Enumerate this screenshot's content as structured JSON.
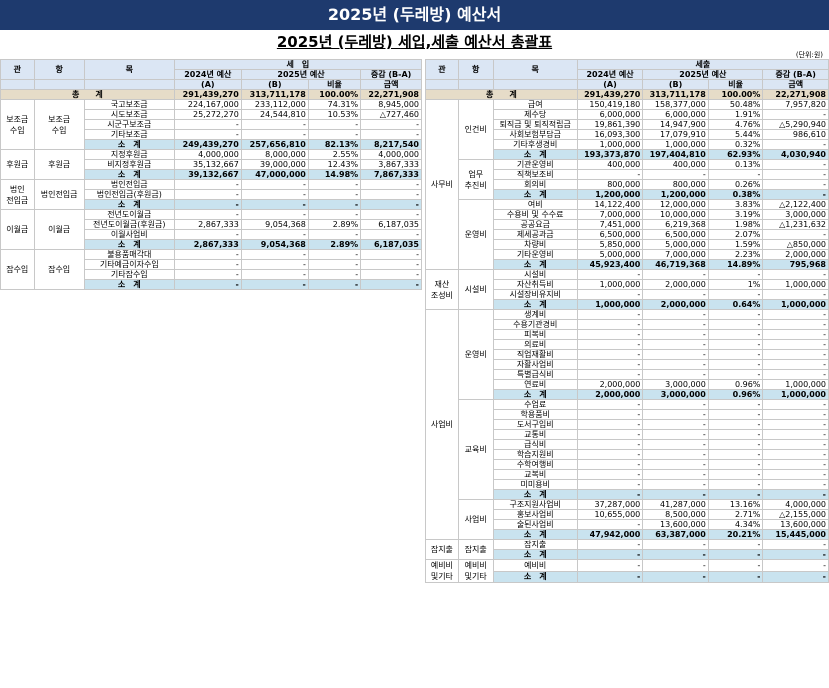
{
  "title": "2025년 (두레방) 예산서",
  "subtitle": "2025년 (두레방) 세입,세출 예산서 총괄표",
  "unit": "(단위:원)",
  "income": {
    "section": "세　입",
    "h": {
      "gwan": "관",
      "hang": "항",
      "mok": "목",
      "y2024": "2024년 예산",
      "y2025": "2025년 예산",
      "ratio": "비율",
      "diff": "증감 (B-A)",
      "a": "(A)",
      "b": "(B)",
      "amount": "금액"
    },
    "total": {
      "label": "총　　계",
      "a": "291,439,270",
      "b": "313,711,178",
      "r": "100.00%",
      "d": "22,271,908"
    },
    "groups": [
      {
        "gwan": "보조금\n수입",
        "hang": "보조금\n수입",
        "rows": [
          {
            "mok": "국고보조금",
            "a": "224,167,000",
            "b": "233,112,000",
            "r": "74.31%",
            "d": "8,945,000"
          },
          {
            "mok": "시도보조금",
            "a": "25,272,270",
            "b": "24,544,810",
            "r": "10.53%",
            "d": "△727,460"
          },
          {
            "mok": "시군구보조금",
            "a": "-",
            "b": "-",
            "r": "-",
            "d": "-"
          },
          {
            "mok": "기타보조금",
            "a": "-",
            "b": "-",
            "r": "-",
            "d": "-"
          }
        ],
        "sub": {
          "label": "소　계",
          "a": "249,439,270",
          "b": "257,656,810",
          "r": "82.13%",
          "d": "8,217,540"
        }
      },
      {
        "gwan": "후원금",
        "hang": "후원금",
        "rows": [
          {
            "mok": "지정후원금",
            "a": "4,000,000",
            "b": "8,000,000",
            "r": "2.55%",
            "d": "4,000,000"
          },
          {
            "mok": "비지정후원금",
            "a": "35,132,667",
            "b": "39,000,000",
            "r": "12.43%",
            "d": "3,867,333"
          }
        ],
        "sub": {
          "label": "소　계",
          "a": "39,132,667",
          "b": "47,000,000",
          "r": "14.98%",
          "d": "7,867,333"
        }
      },
      {
        "gwan": "법인\n전입금",
        "hang": "법인전입금",
        "rows": [
          {
            "mok": "법인전입금",
            "a": "-",
            "b": "-",
            "r": "-",
            "d": "-"
          },
          {
            "mok": "법인전입금(후원금)",
            "a": "-",
            "b": "-",
            "r": "-",
            "d": "-"
          }
        ],
        "sub": {
          "label": "소　계",
          "a": "-",
          "b": "-",
          "r": "-",
          "d": "-"
        }
      },
      {
        "gwan": "이월금",
        "hang": "이월금",
        "rows": [
          {
            "mok": "전년도이월금",
            "a": "-",
            "b": "-",
            "r": "-",
            "d": "-"
          },
          {
            "mok": "전년도이월금(후원금)",
            "a": "2,867,333",
            "b": "9,054,368",
            "r": "2.89%",
            "d": "6,187,035"
          },
          {
            "mok": "이월사업비",
            "a": "-",
            "b": "-",
            "r": "-",
            "d": "-"
          }
        ],
        "sub": {
          "label": "소　계",
          "a": "2,867,333",
          "b": "9,054,368",
          "r": "2.89%",
          "d": "6,187,035"
        }
      },
      {
        "gwan": "잡수입",
        "hang": "잡수입",
        "rows": [
          {
            "mok": "불용품매각대",
            "a": "-",
            "b": "-",
            "r": "-",
            "d": "-"
          },
          {
            "mok": "기타예금이자수입",
            "a": "-",
            "b": "-",
            "r": "-",
            "d": "-"
          },
          {
            "mok": "기타잡수입",
            "a": "-",
            "b": "-",
            "r": "-",
            "d": "-"
          }
        ],
        "sub": {
          "label": "소　계",
          "a": "-",
          "b": "-",
          "r": "-",
          "d": "-"
        }
      }
    ]
  },
  "expense": {
    "section": "세출",
    "h": {
      "gwan": "관",
      "hang": "항",
      "mok": "목",
      "y2024": "2024년 예산",
      "y2025": "2025년 예산",
      "ratio": "비율",
      "diff": "증감 (B-A)",
      "a": "(A)",
      "b": "(B)",
      "amount": "금액"
    },
    "total": {
      "label": "총　　계",
      "a": "291,439,270",
      "b": "313,711,178",
      "r": "100.00%",
      "d": "22,271,908"
    },
    "gwans": [
      {
        "gwan": "사무비",
        "hangs": [
          {
            "hang": "인건비",
            "rows": [
              {
                "mok": "급여",
                "a": "150,419,180",
                "b": "158,377,000",
                "r": "50.48%",
                "d": "7,957,820"
              },
              {
                "mok": "제수당",
                "a": "6,000,000",
                "b": "6,000,000",
                "r": "1.91%",
                "d": "-"
              },
              {
                "mok": "퇴직금 및 퇴직적립금",
                "a": "19,861,390",
                "b": "14,947,900",
                "r": "4.76%",
                "d": "△5,290,940"
              },
              {
                "mok": "사회보험부담금",
                "a": "16,093,300",
                "b": "17,079,910",
                "r": "5.44%",
                "d": "986,610"
              },
              {
                "mok": "기타후생경비",
                "a": "1,000,000",
                "b": "1,000,000",
                "r": "0.32%",
                "d": "-"
              }
            ],
            "sub": {
              "label": "소　계",
              "a": "193,373,870",
              "b": "197,404,810",
              "r": "62.93%",
              "d": "4,030,940"
            }
          },
          {
            "hang": "업무\n추진비",
            "rows": [
              {
                "mok": "기관운영비",
                "a": "400,000",
                "b": "400,000",
                "r": "0.13%",
                "d": "-"
              },
              {
                "mok": "직책보조비",
                "a": "-",
                "b": "-",
                "r": "-",
                "d": "-"
              },
              {
                "mok": "회의비",
                "a": "800,000",
                "b": "800,000",
                "r": "0.26%",
                "d": "-"
              }
            ],
            "sub": {
              "label": "소　계",
              "a": "1,200,000",
              "b": "1,200,000",
              "r": "0.38%",
              "d": "-"
            }
          },
          {
            "hang": "운영비",
            "rows": [
              {
                "mok": "여비",
                "a": "14,122,400",
                "b": "12,000,000",
                "r": "3.83%",
                "d": "△2,122,400"
              },
              {
                "mok": "수용비 및 수수료",
                "a": "7,000,000",
                "b": "10,000,000",
                "r": "3.19%",
                "d": "3,000,000"
              },
              {
                "mok": "공공요금",
                "a": "7,451,000",
                "b": "6,219,368",
                "r": "1.98%",
                "d": "△1,231,632"
              },
              {
                "mok": "제세공과금",
                "a": "6,500,000",
                "b": "6,500,000",
                "r": "2.07%",
                "d": "-"
              },
              {
                "mok": "차량비",
                "a": "5,850,000",
                "b": "5,000,000",
                "r": "1.59%",
                "d": "△850,000"
              },
              {
                "mok": "기타운영비",
                "a": "5,000,000",
                "b": "7,000,000",
                "r": "2.23%",
                "d": "2,000,000"
              }
            ],
            "sub": {
              "label": "소　계",
              "a": "45,923,400",
              "b": "46,719,368",
              "r": "14.89%",
              "d": "795,968"
            }
          }
        ]
      },
      {
        "gwan": "재산\n조성비",
        "hangs": [
          {
            "hang": "시설비",
            "rows": [
              {
                "mok": "시설비",
                "a": "-",
                "b": "-",
                "r": "-",
                "d": "-"
              },
              {
                "mok": "자산취득비",
                "a": "1,000,000",
                "b": "2,000,000",
                "r": "1%",
                "d": "1,000,000"
              },
              {
                "mok": "시설장비유지비",
                "a": "-",
                "b": "-",
                "r": "-",
                "d": "-"
              }
            ],
            "sub": {
              "label": "소　계",
              "a": "1,000,000",
              "b": "2,000,000",
              "r": "0.64%",
              "d": "1,000,000"
            }
          }
        ]
      },
      {
        "gwan": "사업비",
        "hangs": [
          {
            "hang": "운영비",
            "rows": [
              {
                "mok": "생계비",
                "a": "-",
                "b": "-",
                "r": "-",
                "d": "-"
              },
              {
                "mok": "수용기관경비",
                "a": "-",
                "b": "-",
                "r": "-",
                "d": "-"
              },
              {
                "mok": "피복비",
                "a": "-",
                "b": "-",
                "r": "-",
                "d": "-"
              },
              {
                "mok": "의료비",
                "a": "-",
                "b": "-",
                "r": "-",
                "d": "-"
              },
              {
                "mok": "직업재활비",
                "a": "-",
                "b": "-",
                "r": "-",
                "d": "-"
              },
              {
                "mok": "자활사업비",
                "a": "-",
                "b": "-",
                "r": "-",
                "d": "-"
              },
              {
                "mok": "특별급식비",
                "a": "-",
                "b": "-",
                "r": "-",
                "d": "-"
              },
              {
                "mok": "연료비",
                "a": "2,000,000",
                "b": "3,000,000",
                "r": "0.96%",
                "d": "1,000,000"
              }
            ],
            "sub": {
              "label": "소　계",
              "a": "2,000,000",
              "b": "3,000,000",
              "r": "0.96%",
              "d": "1,000,000"
            }
          },
          {
            "hang": "교육비",
            "rows": [
              {
                "mok": "수업료",
                "a": "-",
                "b": "-",
                "r": "-",
                "d": "-"
              },
              {
                "mok": "학용품비",
                "a": "-",
                "b": "-",
                "r": "-",
                "d": "-"
              },
              {
                "mok": "도서구입비",
                "a": "-",
                "b": "-",
                "r": "-",
                "d": "-"
              },
              {
                "mok": "교통비",
                "a": "-",
                "b": "-",
                "r": "-",
                "d": "-"
              },
              {
                "mok": "급식비",
                "a": "-",
                "b": "-",
                "r": "-",
                "d": "-"
              },
              {
                "mok": "학습지원비",
                "a": "-",
                "b": "-",
                "r": "-",
                "d": "-"
              },
              {
                "mok": "수학여행비",
                "a": "-",
                "b": "-",
                "r": "-",
                "d": "-"
              },
              {
                "mok": "교복비",
                "a": "-",
                "b": "-",
                "r": "-",
                "d": "-"
              },
              {
                "mok": "미미용비",
                "a": "-",
                "b": "-",
                "r": "-",
                "d": "-"
              }
            ],
            "sub": {
              "label": "소　계",
              "a": "-",
              "b": "-",
              "r": "-",
              "d": "-"
            }
          },
          {
            "hang": "사업비",
            "rows": [
              {
                "mok": "구조지원사업비",
                "a": "37,287,000",
                "b": "41,287,000",
                "r": "13.16%",
                "d": "4,000,000"
              },
              {
                "mok": "홍보사업비",
                "a": "10,655,000",
                "b": "8,500,000",
                "r": "2.71%",
                "d": "△2,155,000"
              },
              {
                "mok": "술된사업비",
                "a": "-",
                "b": "13,600,000",
                "r": "4.34%",
                "d": "13,600,000"
              }
            ],
            "sub": {
              "label": "소　계",
              "a": "47,942,000",
              "b": "63,387,000",
              "r": "20.21%",
              "d": "15,445,000"
            }
          }
        ]
      },
      {
        "gwan": "잡지출",
        "hangs": [
          {
            "hang": "잡지출",
            "rows": [
              {
                "mok": "잡지출",
                "a": "-",
                "b": "-",
                "r": "-",
                "d": "-"
              }
            ],
            "sub": {
              "label": "소　계",
              "a": "-",
              "b": "-",
              "r": "-",
              "d": "-"
            }
          }
        ]
      },
      {
        "gwan": "예비비\n및기타",
        "hangs": [
          {
            "hang": "예비비\n및기타",
            "rows": [
              {
                "mok": "예비비",
                "a": "-",
                "b": "-",
                "r": "-",
                "d": "-"
              }
            ],
            "sub": {
              "label": "소　계",
              "a": "-",
              "b": "-",
              "r": "-",
              "d": "-"
            }
          }
        ]
      }
    ]
  }
}
